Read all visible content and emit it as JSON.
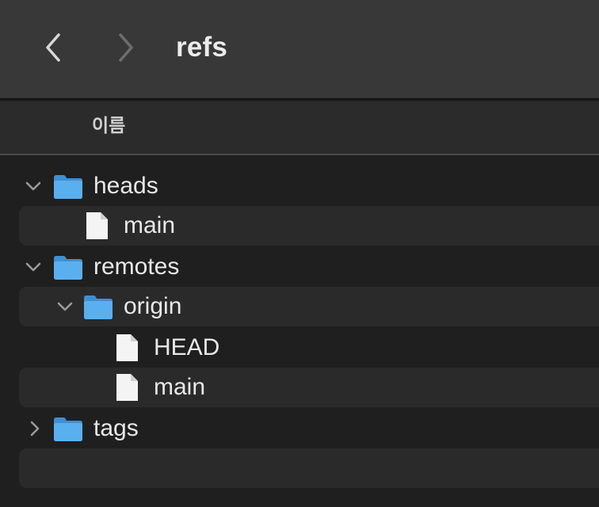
{
  "window": {
    "title": "refs"
  },
  "toolbar": {
    "back_icon": "chevron-left-icon",
    "forward_icon": "chevron-right-icon"
  },
  "columns": {
    "name": "이름"
  },
  "tree": [
    {
      "label": "heads",
      "kind": "folder",
      "expanded": true,
      "depth": 0
    },
    {
      "label": "main",
      "kind": "file",
      "depth": 1
    },
    {
      "label": "remotes",
      "kind": "folder",
      "expanded": true,
      "depth": 0
    },
    {
      "label": "origin",
      "kind": "folder",
      "expanded": true,
      "depth": 1
    },
    {
      "label": "HEAD",
      "kind": "file",
      "depth": 2
    },
    {
      "label": "main",
      "kind": "file",
      "depth": 2
    },
    {
      "label": "tags",
      "kind": "folder",
      "expanded": false,
      "depth": 0
    }
  ],
  "colors": {
    "toolbar_bg": "#383838",
    "list_bg": "#1f1f1f",
    "alt_row_bg": "#2a2a2a",
    "folder_blue": "#5aaeea",
    "text": "#e8e8e8"
  }
}
